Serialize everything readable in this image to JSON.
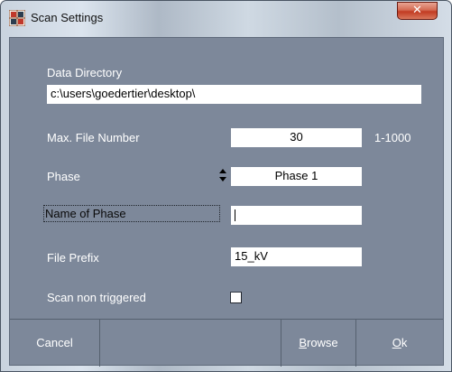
{
  "window": {
    "title": "Scan Settings",
    "close_glyph": "✕",
    "icon": "app-grid-icon"
  },
  "form": {
    "data_directory": {
      "label": "Data Directory",
      "value": "c:\\users\\goedertier\\desktop\\"
    },
    "max_file_number": {
      "label": "Max. File Number",
      "value": "30",
      "range": "1-1000"
    },
    "phase": {
      "label": "Phase",
      "value": "Phase 1",
      "icon": "updown-spinner-icon"
    },
    "name_of_phase": {
      "label": "Name of Phase",
      "value": ""
    },
    "file_prefix": {
      "label": "File Prefix",
      "value": "15_kV"
    },
    "scan_non_triggered": {
      "label": "Scan non triggered",
      "checked": false
    }
  },
  "buttons": {
    "cancel": "Cancel",
    "browse_first": "B",
    "browse_rest": "rowse",
    "ok_first": "O",
    "ok_rest": "k"
  }
}
